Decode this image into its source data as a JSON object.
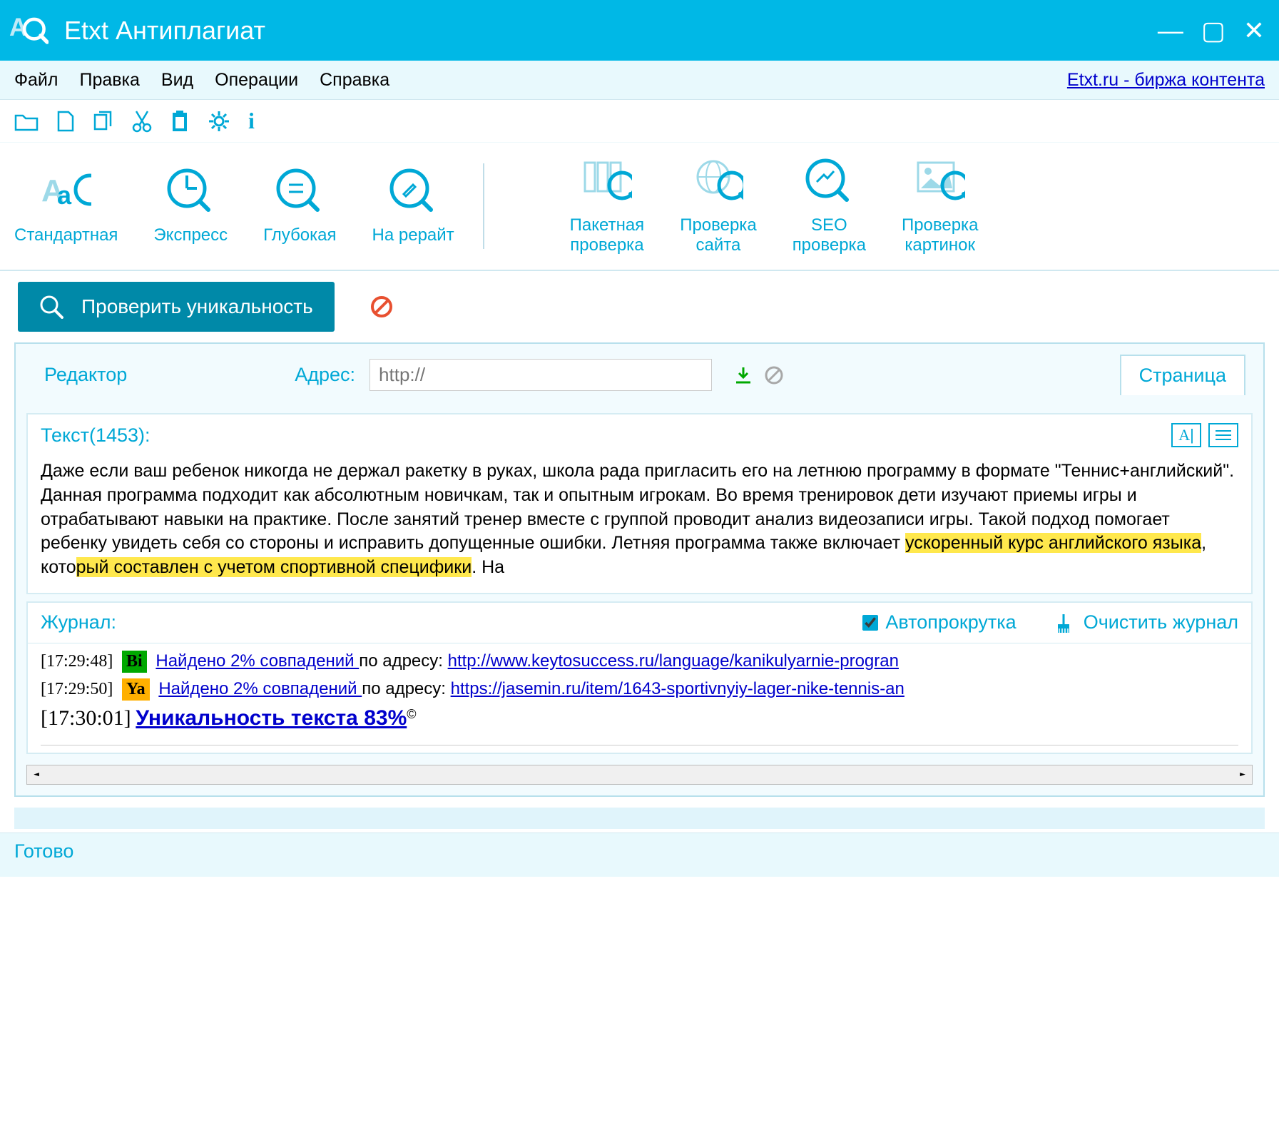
{
  "title": "Etxt Антиплагиат",
  "menu": {
    "file": "Файл",
    "edit": "Правка",
    "view": "Вид",
    "ops": "Операции",
    "help": "Справка",
    "link": "Etxt.ru - биржа контента"
  },
  "big_buttons": {
    "standard": "Стандартная",
    "express": "Экспресс",
    "deep": "Глубокая",
    "rewrite": "На рерайт",
    "batch": {
      "l1": "Пакетная",
      "l2": "проверка"
    },
    "site": {
      "l1": "Проверка",
      "l2": "сайта"
    },
    "seo": {
      "l1": "SEO",
      "l2": "проверка"
    },
    "images": {
      "l1": "Проверка",
      "l2": "картинок"
    }
  },
  "primary_button": "Проверить уникальность",
  "editor": {
    "tab_editor": "Редактор",
    "addr_label": "Адрес:",
    "addr_placeholder": "http://",
    "tab_page": "Страница",
    "text_label": "Текст(1453):",
    "body_plain1": "Даже если ваш ребенок никогда не держал ракетку в руках, школа рада пригласить его на летнюю программу в формате \"Теннис+английский\". Данная программа подходит как абсолютным новичкам, так и опытным игрокам. Во время тренировок дети изучают приемы игры и отрабатывают навыки на практике. После занятий тренер вместе с группой проводит анализ видеозаписи игры. Такой подход помогает ребенку увидеть себя со стороны и исправить допущенные ошибки. Летняя программа также включает ",
    "body_hl1": "ускоренный курс английского языка",
    "body_plain2": ", кото",
    "body_hl2": "рый составлен с учетом спортивной специфики",
    "body_plain3": ". На"
  },
  "log": {
    "label": "Журнал:",
    "autoscroll": "Автопрокрутка",
    "clear": "Очистить журнал",
    "rows": [
      {
        "ts": "[17:29:48]",
        "src": "Bi",
        "text": "Найдено 2% совпадений ",
        "plain": "по адресу: ",
        "url": "http://www.keytosuccess.ru/language/kanikulyarnie-progran"
      },
      {
        "ts": "[17:29:50]",
        "src": "Ya",
        "text": "Найдено 2% совпадений ",
        "plain": "по адресу: ",
        "url": "https://jasemin.ru/item/1643-sportivnyiy-lager-nike-tennis-an"
      }
    ],
    "result_ts": "[17:30:01]",
    "result": "Уникальность текста 83%"
  },
  "status": "Готово"
}
